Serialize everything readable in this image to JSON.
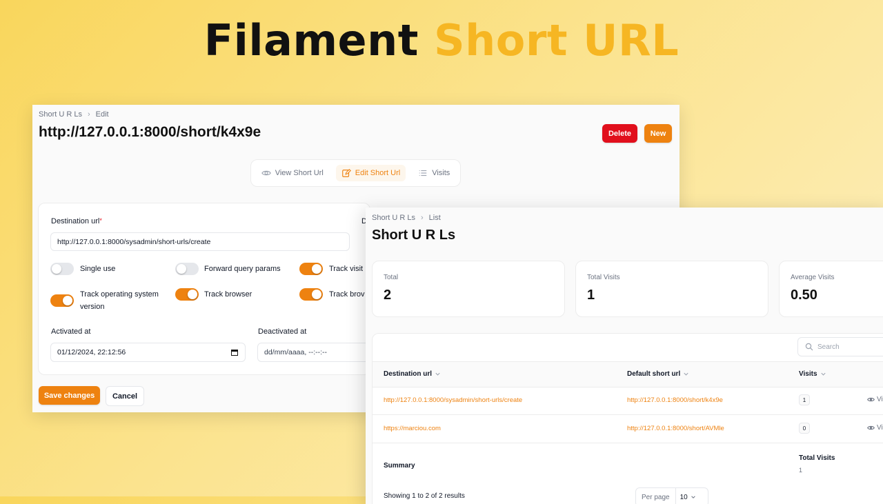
{
  "hero": {
    "word1": "Filament",
    "word2": "Short URL"
  },
  "edit_page": {
    "breadcrumb": [
      "Short U R Ls",
      "Edit"
    ],
    "title": "http://127.0.0.1:8000/short/k4x9e",
    "actions": {
      "delete": "Delete",
      "new": "New"
    },
    "tabs": [
      {
        "label": "View Short Url",
        "icon": "eye-icon"
      },
      {
        "label": "Edit Short Url",
        "icon": "pencil-square-icon",
        "active": true
      },
      {
        "label": "Visits",
        "icon": "list-icon"
      }
    ],
    "form": {
      "destination_label": "Destination url",
      "required_mark": "*",
      "destination_value": "http://127.0.0.1:8000/sysadmin/short-urls/create",
      "cut_label_fragment": "D",
      "toggles": [
        {
          "label": "Single use",
          "on": false
        },
        {
          "label": "Forward query params",
          "on": false
        },
        {
          "label": "Track visits",
          "visible": "Track visit",
          "on": true
        },
        {
          "label": "Track operating system version",
          "on": true
        },
        {
          "label": "Track browser",
          "on": true
        },
        {
          "label": "Track browser version",
          "visible": "Track brov",
          "on": true
        }
      ],
      "activated_label": "Activated at",
      "activated_value": "01/12/2024, 22:12:56",
      "deactivated_label": "Deactivated at",
      "deactivated_placeholder": "dd/mm/aaaa, --:--:--"
    },
    "footer": {
      "save": "Save changes",
      "cancel": "Cancel"
    }
  },
  "list_page": {
    "breadcrumb": [
      "Short U R Ls",
      "List"
    ],
    "title": "Short U R Ls",
    "stats": [
      {
        "label": "Total",
        "value": "2"
      },
      {
        "label": "Total Visits",
        "value": "1"
      },
      {
        "label": "Average Visits",
        "value": "0.50"
      }
    ],
    "search_placeholder": "Search",
    "columns": [
      "Destination url",
      "Default short url",
      "Visits"
    ],
    "rows": [
      {
        "destination": "http://127.0.0.1:8000/sysadmin/short-urls/create",
        "short": "http://127.0.0.1:8000/short/k4x9e",
        "visits": "1",
        "action": "Vi"
      },
      {
        "destination": "https://marciou.com",
        "short": "http://127.0.0.1:8000/short/AVMle",
        "visits": "0",
        "action": "Vi"
      }
    ],
    "summary": {
      "label": "Summary",
      "visits_header": "Total Visits",
      "visits_value": "1"
    },
    "pagination": {
      "text": "Showing 1 to 2 of 2 results",
      "per_page_label": "Per page",
      "per_page_value": "10"
    }
  },
  "colors": {
    "primary": "#ee8210",
    "danger": "#e10f1c",
    "hero_accent": "#f6b623"
  }
}
